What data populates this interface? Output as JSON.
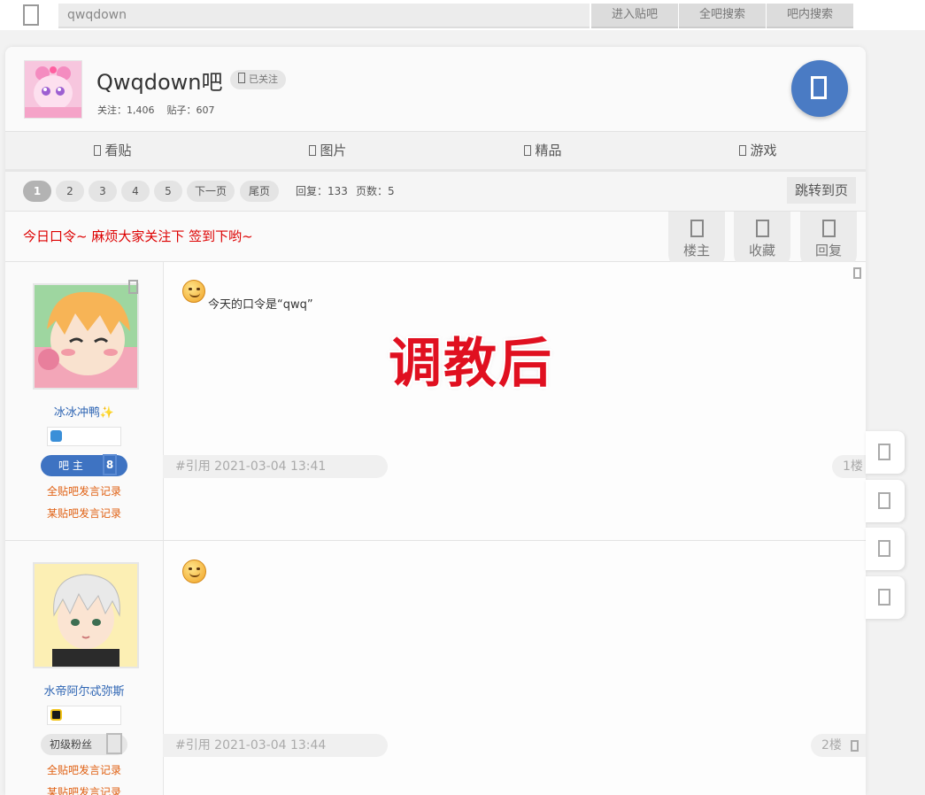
{
  "topbar": {
    "search_placeholder": "qwqdown",
    "buttons": [
      "进入贴吧",
      "全吧搜索",
      "吧内搜索"
    ]
  },
  "forum": {
    "title": "Qwqdown吧",
    "follow_badge": "已关注",
    "stats_follow": "关注：1,406",
    "stats_posts": "贴子：607"
  },
  "nav": {
    "tabs": [
      "看贴",
      "图片",
      "精品",
      "游戏"
    ]
  },
  "pager": {
    "pages": [
      "1",
      "2",
      "3",
      "4",
      "5"
    ],
    "current_page": "1",
    "next": "下一页",
    "last": "尾页",
    "replies": "回复：133",
    "page_count": "页数：5",
    "jump": "跳转到页"
  },
  "thread": {
    "title": "今日口令~ 麻烦大家关注下 签到下哟~",
    "actions": [
      "楼主",
      "收藏",
      "回复"
    ]
  },
  "posts": [
    {
      "author": "冰冰冲鸭✨",
      "level_title": "吧 主",
      "level_num": "8",
      "link_all": "全贴吧发言记录",
      "link_forum": "某贴吧发言记录",
      "content": "今天的口令是“qwq”",
      "overlay": "调教后",
      "meta": "#引用 2021-03-04 13:41",
      "floor": "1楼"
    },
    {
      "author": "水帝阿尔忒弥斯",
      "level_title": "初级粉丝",
      "level_num": "",
      "link_all": "全贴吧发言记录",
      "link_forum": "某贴吧发言记录",
      "content": "",
      "meta": "#引用 2021-03-04 13:44",
      "floor": "2楼"
    }
  ],
  "colors": {
    "accent": "#4a7bc4",
    "notice_red": "#dd0000",
    "link_orange": "#e06012",
    "author_blue": "#2d64b3"
  }
}
